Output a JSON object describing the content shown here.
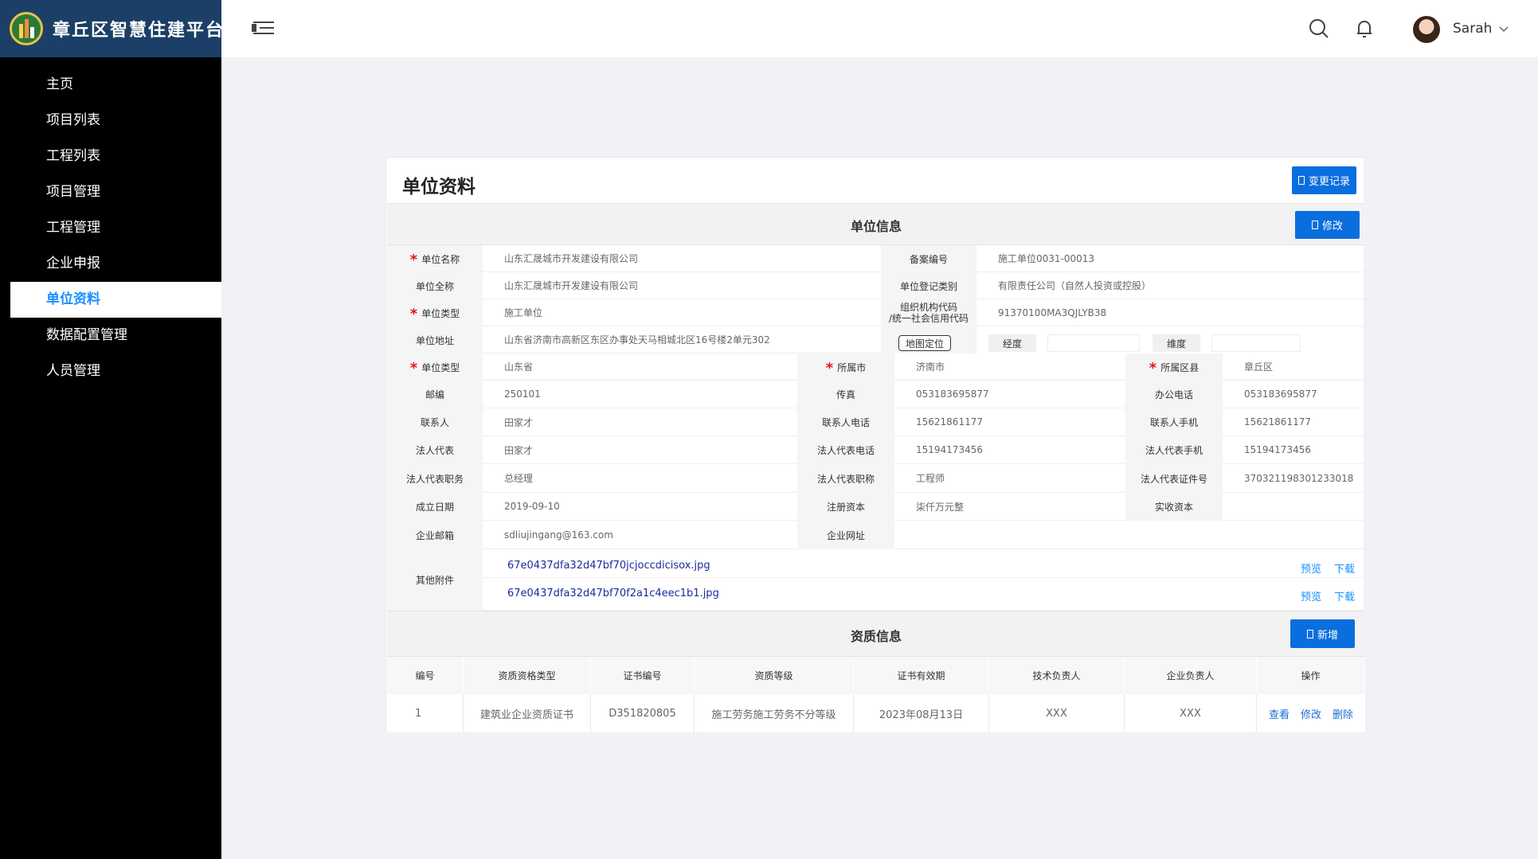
{
  "app": {
    "title": "章丘区智慧住建平台"
  },
  "sidebar": {
    "items": [
      {
        "label": "主页"
      },
      {
        "label": "项目列表"
      },
      {
        "label": "工程列表"
      },
      {
        "label": "项目管理"
      },
      {
        "label": "工程管理"
      },
      {
        "label": "企业申报"
      },
      {
        "label": "单位资料",
        "active": true
      },
      {
        "label": "数据配置管理"
      },
      {
        "label": "人员管理"
      }
    ]
  },
  "header": {
    "user_name": "Sarah"
  },
  "page": {
    "title": "单位资料",
    "change_log_button": "变更记录"
  },
  "unit_info": {
    "section_title": "单位信息",
    "edit_button": "修改",
    "labels": {
      "unit_name": "单位名称",
      "record_no": "备案编号",
      "full_name": "单位全称",
      "reg_type": "单位登记类别",
      "unit_type": "单位类型",
      "org_code_1": "组织机构代码",
      "org_code_2": "/统一社会信用代码",
      "address": "单位地址",
      "map_button": "地图定位",
      "longitude": "经度",
      "latitude": "维度",
      "province": "单位类型",
      "city": "所属市",
      "district": "所属区县",
      "postcode": "邮编",
      "fax": "传真",
      "office_phone": "办公电话",
      "contact": "联系人",
      "contact_phone": "联系人电话",
      "contact_mobile": "联系人手机",
      "legal_rep": "法人代表",
      "legal_phone": "法人代表电话",
      "legal_mobile": "法人代表手机",
      "legal_post": "法人代表职务",
      "legal_title": "法人代表职称",
      "legal_id": "法人代表证件号",
      "found_date": "成立日期",
      "reg_capital": "注册资本",
      "paid_capital": "实收资本",
      "email": "企业邮箱",
      "website": "企业网址",
      "attachments": "其他附件"
    },
    "values": {
      "unit_name": "山东汇晟城市开发建设有限公司",
      "record_no": "施工单位0031-00013",
      "full_name": "山东汇晟城市开发建设有限公司",
      "reg_type": "有限责任公司（自然人投资或控股）",
      "unit_type": "施工单位",
      "org_code": "91370100MA3QJLYB38",
      "address": "山东省济南市高新区东区办事处天马相城北区16号楼2单元302",
      "longitude": "",
      "latitude": "",
      "province": "山东省",
      "city": "济南市",
      "district": "章丘区",
      "postcode": "250101",
      "fax": "053183695877",
      "office_phone": "053183695877",
      "contact": "田家才",
      "contact_phone": "15621861177",
      "contact_mobile": "15621861177",
      "legal_rep": "田家才",
      "legal_phone": "15194173456",
      "legal_mobile": "15194173456",
      "legal_post": "总经理",
      "legal_title": "工程师",
      "legal_id": "370321198301233018",
      "found_date": "2019-09-10",
      "reg_capital": "柒仟万元整",
      "paid_capital": "",
      "email": "sdliujingang@163.com",
      "website": ""
    },
    "attachments": [
      {
        "name": "67e0437dfa32d47bf70jcjoccdicisox.jpg",
        "preview": "预览",
        "download": "下载"
      },
      {
        "name": "67e0437dfa32d47bf70f2a1c4eec1b1.jpg",
        "preview": "预览",
        "download": "下载"
      }
    ]
  },
  "qualification": {
    "section_title": "资质信息",
    "add_button": "新增",
    "columns": [
      "编号",
      "资质资格类型",
      "证书编号",
      "资质等级",
      "证书有效期",
      "技术负责人",
      "企业负责人",
      "操作"
    ],
    "rows": [
      {
        "no": "1",
        "type": "建筑业企业资质证书",
        "cert_no": "D351820805",
        "level": "施工劳务施工劳务不分等级",
        "valid": "2023年08月13日",
        "tech_lead": "XXX",
        "corp_lead": "XXX",
        "actions": [
          "查看",
          "修改",
          "删除"
        ]
      }
    ]
  }
}
